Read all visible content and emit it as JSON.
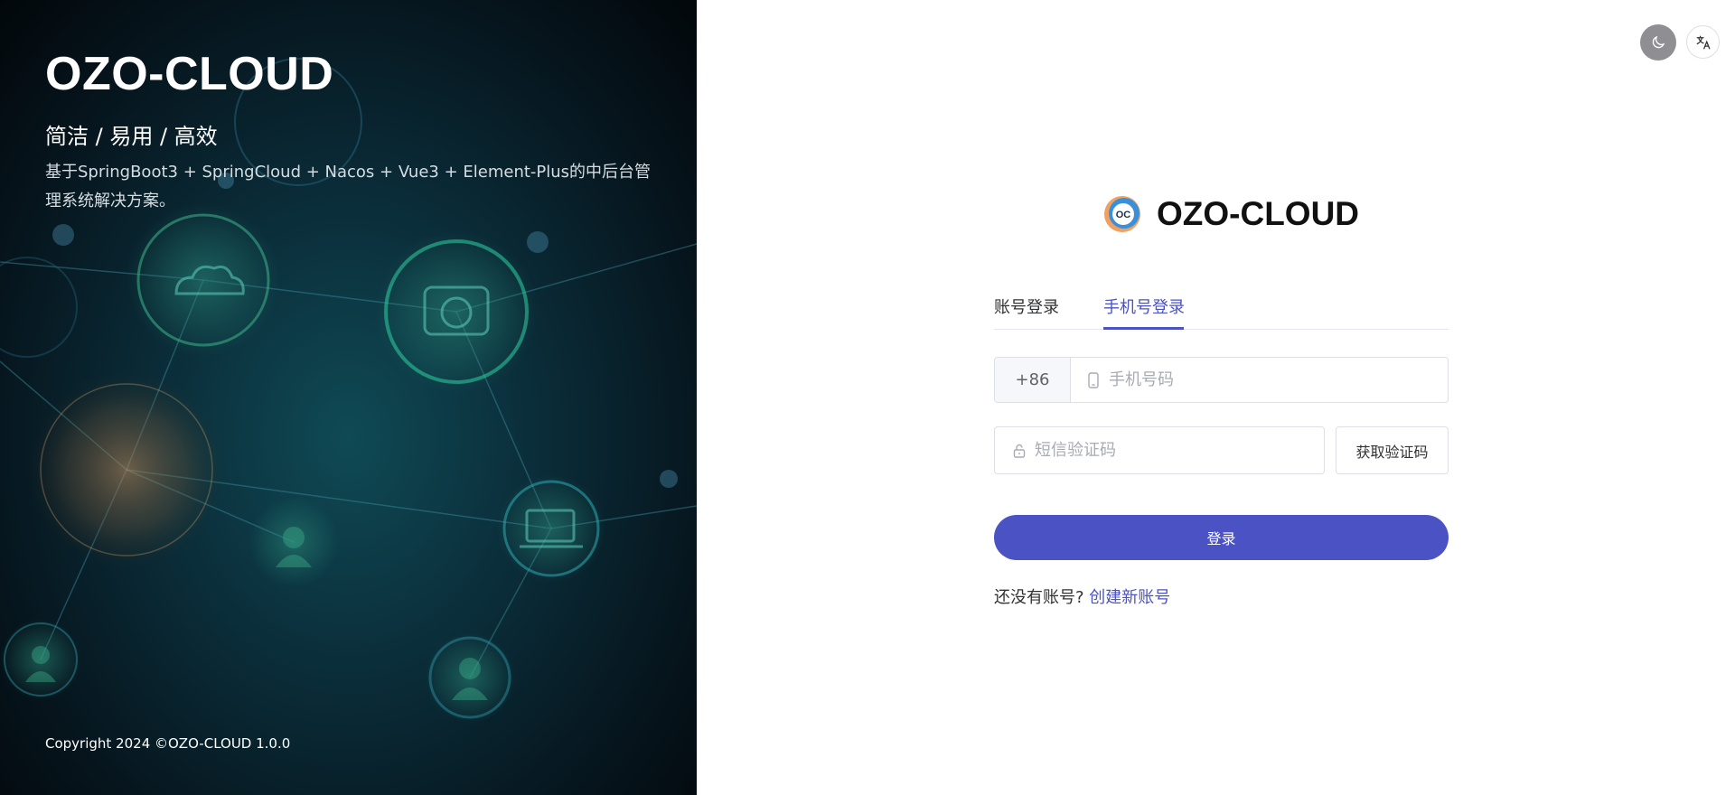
{
  "brand": {
    "title": "OZO-CLOUD",
    "subtitle": "简洁 / 易用 / 高效",
    "description": "基于SpringBoot3 + SpringCloud + Nacos + Vue3 + Element-Plus的中后台管理系统解决方案。",
    "copyright": "Copyright 2024 ©OZO-CLOUD 1.0.0"
  },
  "header": {
    "theme_icon": "moon-icon",
    "language_icon": "translate-icon"
  },
  "logo": {
    "badge_text": "OC",
    "text": "OZO-CLOUD"
  },
  "tabs": [
    {
      "label": "账号登录",
      "active": false
    },
    {
      "label": "手机号登录",
      "active": true
    }
  ],
  "form": {
    "country_code": "+86",
    "phone_placeholder": "手机号码",
    "phone_value": "",
    "code_placeholder": "短信验证码",
    "code_value": "",
    "get_code_label": "获取验证码",
    "login_label": "登录"
  },
  "signup": {
    "prompt": "还没有账号?",
    "link": "创建新账号"
  },
  "colors": {
    "accent": "#4b52c4",
    "left_bg": "#0a2c38"
  }
}
